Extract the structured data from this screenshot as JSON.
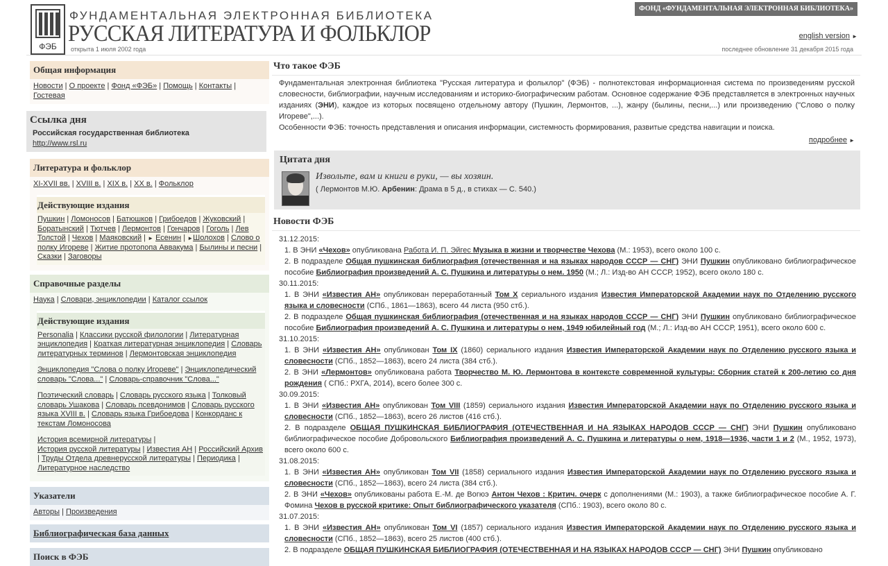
{
  "header": {
    "logo_letters": "ФЭБ",
    "title_small": "ФУНДАМЕНТАЛЬНАЯ ЭЛЕКТРОННАЯ БИБЛИОТЕКА",
    "title_big": "РУССКАЯ ЛИТЕРАТУРА И ФОЛЬКЛОР",
    "opened": "открыта 1 июля 2002 года",
    "updated": "последнее обновление 31 декабря 2015 года",
    "fund_badge": "ФОНД «ФУНДАМЕНТАЛЬНАЯ ЭЛЕКТРОННАЯ БИБЛИОТЕКА»",
    "english_link": "english version",
    "arrow": "►"
  },
  "left": {
    "general": {
      "title": "Общая информация",
      "links": [
        "Новости",
        "О проекте",
        "Фонд «ФЭБ»",
        "Помощь",
        "Контакты",
        "Гостевая"
      ]
    },
    "link_of_day": {
      "title": "Ссылка дня",
      "institution": "Российская государственная библиотека",
      "url": "http://www.rsl.ru"
    },
    "literature": {
      "title": "Литература и фольклор",
      "links": [
        "XI-XVII вв.",
        "XVIII в.",
        "XIX в.",
        "XX в.",
        "Фольклор"
      ],
      "active_title": "Действующие издания",
      "active_links": [
        "Пушкин",
        "Ломоносов",
        "Батюшков",
        "Грибоедов",
        "Жуковский",
        "Боратынский",
        "Тютчев",
        "Лермонтов",
        "Гончаров",
        "Гоголь",
        "Лев Толстой",
        "Чехов",
        "Маяковский",
        "Есенин",
        "Шолохов",
        "Слово о полку Игореве",
        "Житие протопопа Аввакума",
        "Былины и песни",
        "Сказки",
        "Заговоры"
      ]
    },
    "reference": {
      "title": "Справочные разделы",
      "links": [
        "Наука",
        "Словари, энциклопедии",
        "Каталог ссылок"
      ],
      "active_title": "Действующие издания",
      "group1": [
        "Personalia",
        "Классики русской филологии",
        "Литературная энциклопедия",
        "Краткая литературная энциклопедия",
        "Словарь литературных терминов",
        "Лермонтовская энциклопедия"
      ],
      "group2": [
        "Энциклопедия \"Слова о полку Игореве\"",
        "Энциклопедический словарь \"Слова...\"",
        "Словарь-справочник \"Слова...\""
      ],
      "group3": [
        "Поэтический словарь",
        "Словарь русского языка",
        "Толковый словарь Ушакова",
        "Словарь псевдонимов",
        "Словарь русского языка XVIII в.",
        "Словарь языка Грибоедова",
        "Конкорданс к текстам Ломоносова"
      ],
      "group4": [
        "История всемирной литературы",
        "История русской литературы",
        "Известия АН",
        "Российский Архив",
        "Труды Отдела древнерусской литературы",
        "Периодика",
        "Литературное наследство"
      ]
    },
    "indexes": {
      "title": "Указатели",
      "links": [
        "Авторы",
        "Произведения"
      ]
    },
    "biblio_db": {
      "title": "Библиографическая база данных"
    },
    "search": {
      "title": "Поиск в ФЭБ"
    }
  },
  "right": {
    "about": {
      "title": "Что такое ФЭБ",
      "p1_a": "Фундаментальная электронная библиотека \"Русская литература и фольклор\" (ФЭБ) - полнотекстовая информационная система по произведениям русской словесности, библиографии, научным исследованиям и историко-биографическим работам. Основное содержание ФЭБ представляется в электронных научных изданиях (",
      "p1_eni": "ЭНИ",
      "p1_b": "), каждое из которых посвящено отдельному автору (Пушкин, Лермонтов, ...), жанру (былины, песни,...) или произведению (\"Слово о полку Игореве\",...).",
      "p2": "Особенности ФЭБ: точность представления и описания информации, системность формирования, развитые средства навигации и поиска.",
      "more": "подробнее"
    },
    "quote": {
      "title": "Цитата дня",
      "text": "Извольте, вам и книги в руки, — вы хозяин.",
      "src_open": "( Лермонтов М.Ю. ",
      "src_hero": "Арбенин",
      "src_close": ": Драма в 5 д., в стихах — С. 540.)"
    },
    "news": {
      "title": "Новости ФЭБ",
      "d1": "31.12.2015:",
      "d1_1": [
        "1. В ЭНИ ",
        "«Чехов»",
        " опубликована ",
        "Работа И. П. Эйгес ",
        "Музыка в жизни и творчестве Чехова",
        " (М.: 1953), всего около 100 с."
      ],
      "d1_2": [
        "2. В подразделе ",
        "Общая пушкинская библиография (отечественная и на языках народов СССР — СНГ)",
        " ЭНИ ",
        "Пушкин",
        " опубликовано библиографическое пособие ",
        "Библиография произведений А. С. Пушкина и литературы о нем. 1950",
        " (М.; Л.: Изд-во АН СССР, 1952), всего около 180 с."
      ],
      "d2": "30.11.2015:",
      "d2_1": [
        "1. В ЭНИ ",
        "«Известия АН»",
        " опубликован переработанный ",
        "Том X",
        " сериального издания ",
        "Известия Императорской Академии наук по Отделению русского языка и словесности",
        " (СПб., 1861—1863), всего 44 листа (950 стб.)."
      ],
      "d2_2": [
        "2. В подразделе ",
        "Общая пушкинская библиография (отечественная и на языках народов СССР — СНГ)",
        " ЭНИ ",
        "Пушкин",
        " опубликовано библиографическое пособие ",
        "Библиография произведений А. С. Пушкина и литературы о нем, 1949 юбилейный год",
        " (М.; Л.: Изд-во АН СССР, 1951), всего около 600 с."
      ],
      "d3": "31.10.2015:",
      "d3_1": [
        "1. В ЭНИ ",
        "«Известия АН»",
        " опубликован ",
        "Том IX",
        " (1860) сериального издания ",
        "Известия Императорской Академии наук по Отделению русского языка и словесности",
        " (СПб., 1852—1863), всего 24 листа (384 стб.)."
      ],
      "d3_2": [
        "2. В ЭНИ ",
        "«Лермонтов»",
        " опубликована работа ",
        "Творчество М. Ю. Лермонтова в контексте современной культуры: Сборник статей к 200-летию со дня рождения",
        " ( СПб.: РХГА, 2014), всего более 300 с."
      ],
      "d4": "30.09.2015:",
      "d4_1": [
        "1. В ЭНИ ",
        "«Известия АН»",
        " опубликован ",
        "Том VIII",
        " (1859) сериального издания ",
        "Известия Императорской Академии наук по Отделению русского языка и словесности",
        " (СПб., 1852—1863), всего 26 листов (416 стб.)."
      ],
      "d4_2": [
        "2. В подразделе ",
        "ОБЩАЯ ПУШКИНСКАЯ БИБЛИОГРАФИЯ (ОТЕЧЕСТВЕННАЯ И НА ЯЗЫКАХ НАРОДОВ СССР — СНГ)",
        " ЭНИ ",
        "Пушкин",
        " опубликовано библиографическое пособие Добровольского ",
        "Библиография произведений А. С. Пушкина и литературы о нем, 1918—1936, части 1 и 2",
        " (М., 1952, 1973), всего около 600 с."
      ],
      "d5": "31.08.2015:",
      "d5_1": [
        "1. В ЭНИ ",
        "«Известия АН»",
        " опубликован ",
        "Том VII",
        " (1858) сериального издания ",
        "Известия Императорской Академии наук по Отделению русского языка и словесности",
        " (СПб., 1852—1863), всего 24 листа (384 стб.)."
      ],
      "d5_2": [
        "2. В ЭНИ ",
        "«Чехов»",
        " опубликованы работа Е.-М. де Вогюэ ",
        "Антон Чехов : Критич. очерк",
        " с дополнениями (М.: 1903), а также библиографическое пособие А. Г. Фомина ",
        "Чехов в русской критике: Опыт библиографического указателя",
        " (СПб.: 1903), всего около 80 с."
      ],
      "d6": "31.07.2015:",
      "d6_1": [
        "1. В ЭНИ ",
        "«Известия АН»",
        " опубликован ",
        "Том VI",
        " (1857) сериального издания ",
        "Известия Императорской Академии наук по Отделению русского языка и словесности",
        " (СПб., 1852—1863), всего 25 листов (400 стб.)."
      ],
      "d6_2": [
        "2. В подразделе ",
        "ОБЩАЯ ПУШКИНСКАЯ БИБЛИОГРАФИЯ (ОТЕЧЕСТВЕННАЯ И НА ЯЗЫКАХ НАРОДОВ СССР — СНГ)",
        " ЭНИ ",
        "Пушкин",
        " опубликовано"
      ]
    }
  }
}
